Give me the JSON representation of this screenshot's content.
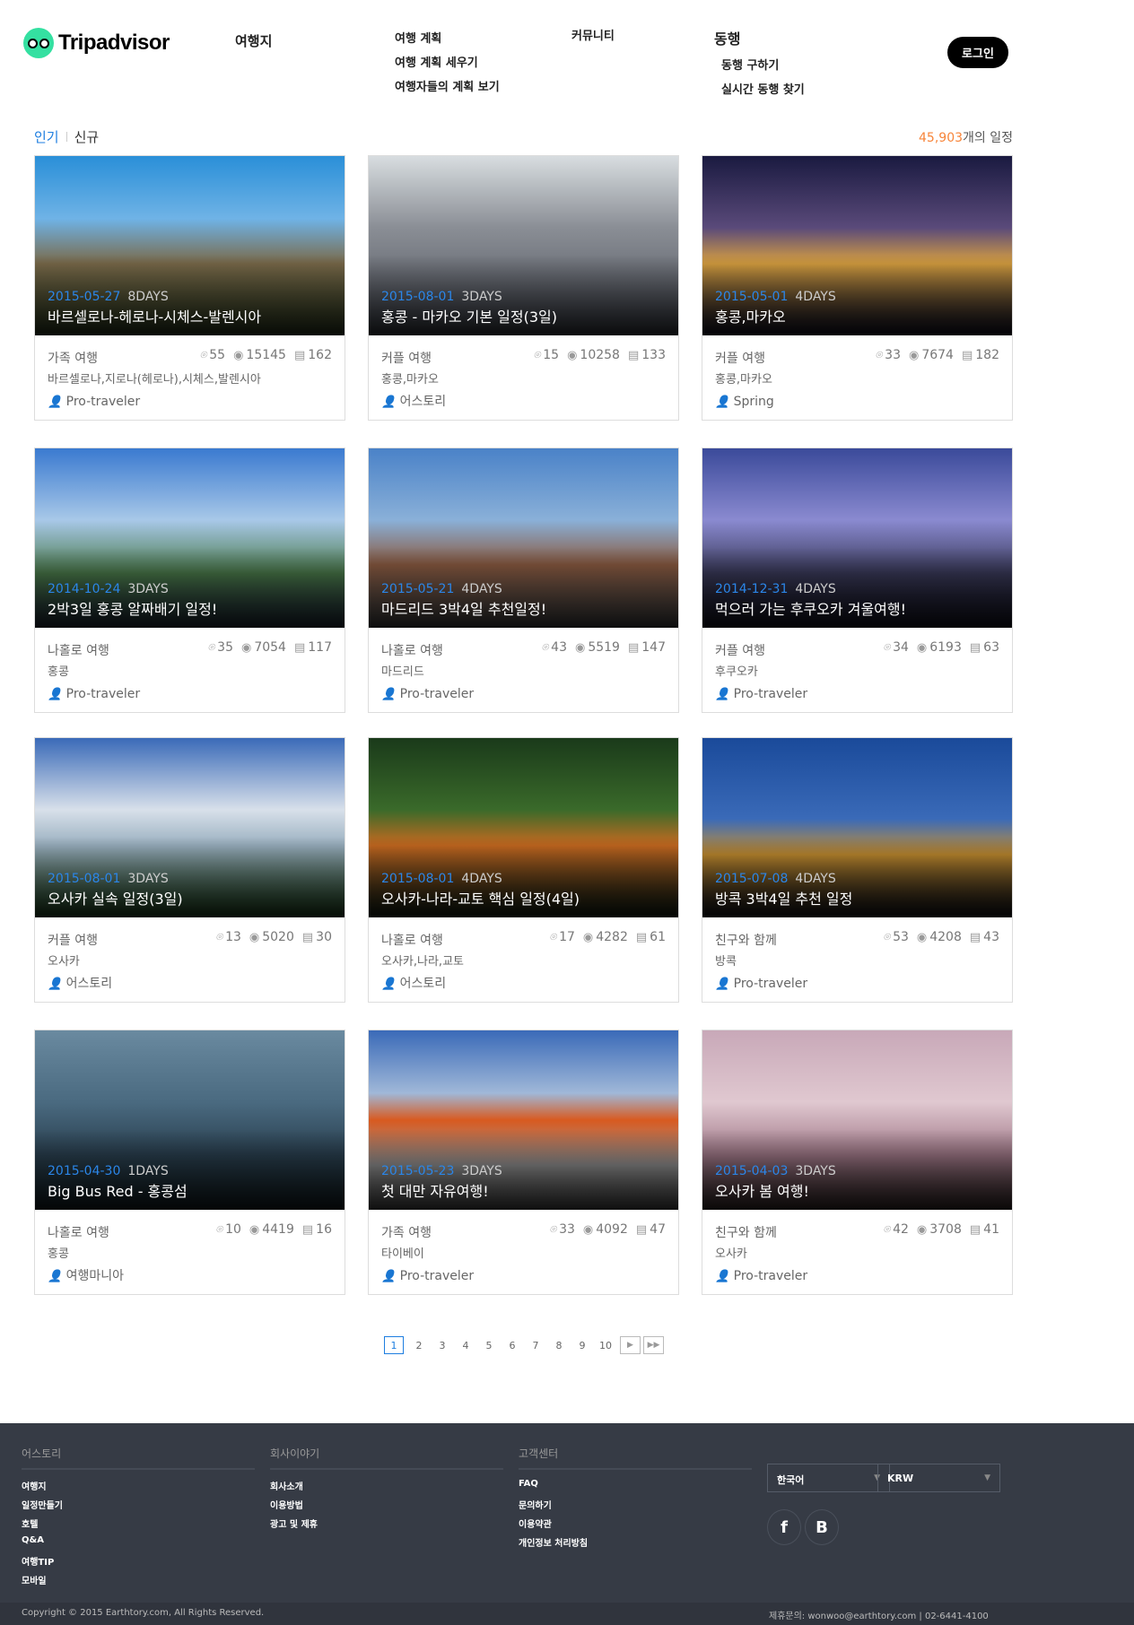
{
  "header": {
    "logo": "Tripadvisor",
    "nav": {
      "destinations": "여행지",
      "plan": {
        "title": "여행 계획",
        "items": [
          "여행 계획 세우기",
          "여행자들의 계획 보기"
        ]
      },
      "community": "커뮤니티",
      "companion": {
        "title": "동행",
        "items": [
          "동행 구하기",
          "실시간 동행 찾기"
        ]
      }
    },
    "login": "로그인"
  },
  "tabs": {
    "popular": "인기",
    "new": "신규"
  },
  "count": {
    "number": "45,903",
    "suffix": "개의 일정"
  },
  "cards": [
    {
      "date": "2015-05-27",
      "days": "8DAYS",
      "title": "바르셀로나-헤로나-시체스-발렌시아",
      "type": "가족 여행",
      "places": "55",
      "views": "15145",
      "posts": "162",
      "cities": "바르셀로나,지로나(헤로나),시체스,발렌시아",
      "author": "Pro-traveler"
    },
    {
      "date": "2015-08-01",
      "days": "3DAYS",
      "title": "홍콩 - 마카오 기본 일정(3일)",
      "type": "커플 여행",
      "places": "15",
      "views": "10258",
      "posts": "133",
      "cities": "홍콩,마카오",
      "author": "어스토리"
    },
    {
      "date": "2015-05-01",
      "days": "4DAYS",
      "title": "홍콩,마카오",
      "type": "커플 여행",
      "places": "33",
      "views": "7674",
      "posts": "182",
      "cities": "홍콩,마카오",
      "author": "Spring"
    },
    {
      "date": "2014-10-24",
      "days": "3DAYS",
      "title": "2박3일 홍콩 알짜배기 일정!",
      "type": "나홀로 여행",
      "places": "35",
      "views": "7054",
      "posts": "117",
      "cities": "홍콩",
      "author": "Pro-traveler"
    },
    {
      "date": "2015-05-21",
      "days": "4DAYS",
      "title": "마드리드 3박4일 추천일정!",
      "type": "나홀로 여행",
      "places": "43",
      "views": "5519",
      "posts": "147",
      "cities": "마드리드",
      "author": "Pro-traveler"
    },
    {
      "date": "2014-12-31",
      "days": "4DAYS",
      "title": "먹으러 가는 후쿠오카 겨울여행!",
      "type": "커플 여행",
      "places": "34",
      "views": "6193",
      "posts": "63",
      "cities": "후쿠오카",
      "author": "Pro-traveler"
    },
    {
      "date": "2015-08-01",
      "days": "3DAYS",
      "title": "오사카 실속 일정(3일)",
      "type": "커플 여행",
      "places": "13",
      "views": "5020",
      "posts": "30",
      "cities": "오사카",
      "author": "어스토리"
    },
    {
      "date": "2015-08-01",
      "days": "4DAYS",
      "title": "오사카-나라-교토 핵심 일정(4일)",
      "type": "나홀로 여행",
      "places": "17",
      "views": "4282",
      "posts": "61",
      "cities": "오사카,나라,교토",
      "author": "어스토리"
    },
    {
      "date": "2015-07-08",
      "days": "4DAYS",
      "title": "방콕 3박4일 추천 일정",
      "type": "친구와 함께",
      "places": "53",
      "views": "4208",
      "posts": "43",
      "cities": "방콕",
      "author": "Pro-traveler"
    },
    {
      "date": "2015-04-30",
      "days": "1DAYS",
      "title": "Big Bus Red - 홍콩섬",
      "type": "나홀로 여행",
      "places": "10",
      "views": "4419",
      "posts": "16",
      "cities": "홍콩",
      "author": "여행마니아"
    },
    {
      "date": "2015-05-23",
      "days": "3DAYS",
      "title": "첫 대만 자유여행!",
      "type": "가족 여행",
      "places": "33",
      "views": "4092",
      "posts": "47",
      "cities": "타이베이",
      "author": "Pro-traveler"
    },
    {
      "date": "2015-04-03",
      "days": "3DAYS",
      "title": "오사카 봄 여행!",
      "type": "친구와 함께",
      "places": "42",
      "views": "3708",
      "posts": "41",
      "cities": "오사카",
      "author": "Pro-traveler"
    }
  ],
  "pagination": {
    "pages": [
      "1",
      "2",
      "3",
      "4",
      "5",
      "6",
      "7",
      "8",
      "9",
      "10"
    ],
    "current": "1"
  },
  "footer": {
    "columns": [
      {
        "title": "어스토리",
        "links": [
          "여행지",
          "일정만들기",
          "호텔",
          "Q&A",
          "여행TIP",
          "모바일"
        ]
      },
      {
        "title": "회사이야기",
        "links": [
          "회사소개",
          "이용방법",
          "광고 및 제휴"
        ]
      },
      {
        "title": "고객센터",
        "links": [
          "FAQ",
          "문의하기",
          "이용약관",
          "개인정보 처리방침"
        ]
      }
    ],
    "language": "한국어",
    "currency": "KRW",
    "copyright": "Copyright © 2015 Earthtory.com, All Rights Reserved.",
    "contact": "제휴문의: wonwoo@earthtory.com | 02-6441-4100"
  }
}
